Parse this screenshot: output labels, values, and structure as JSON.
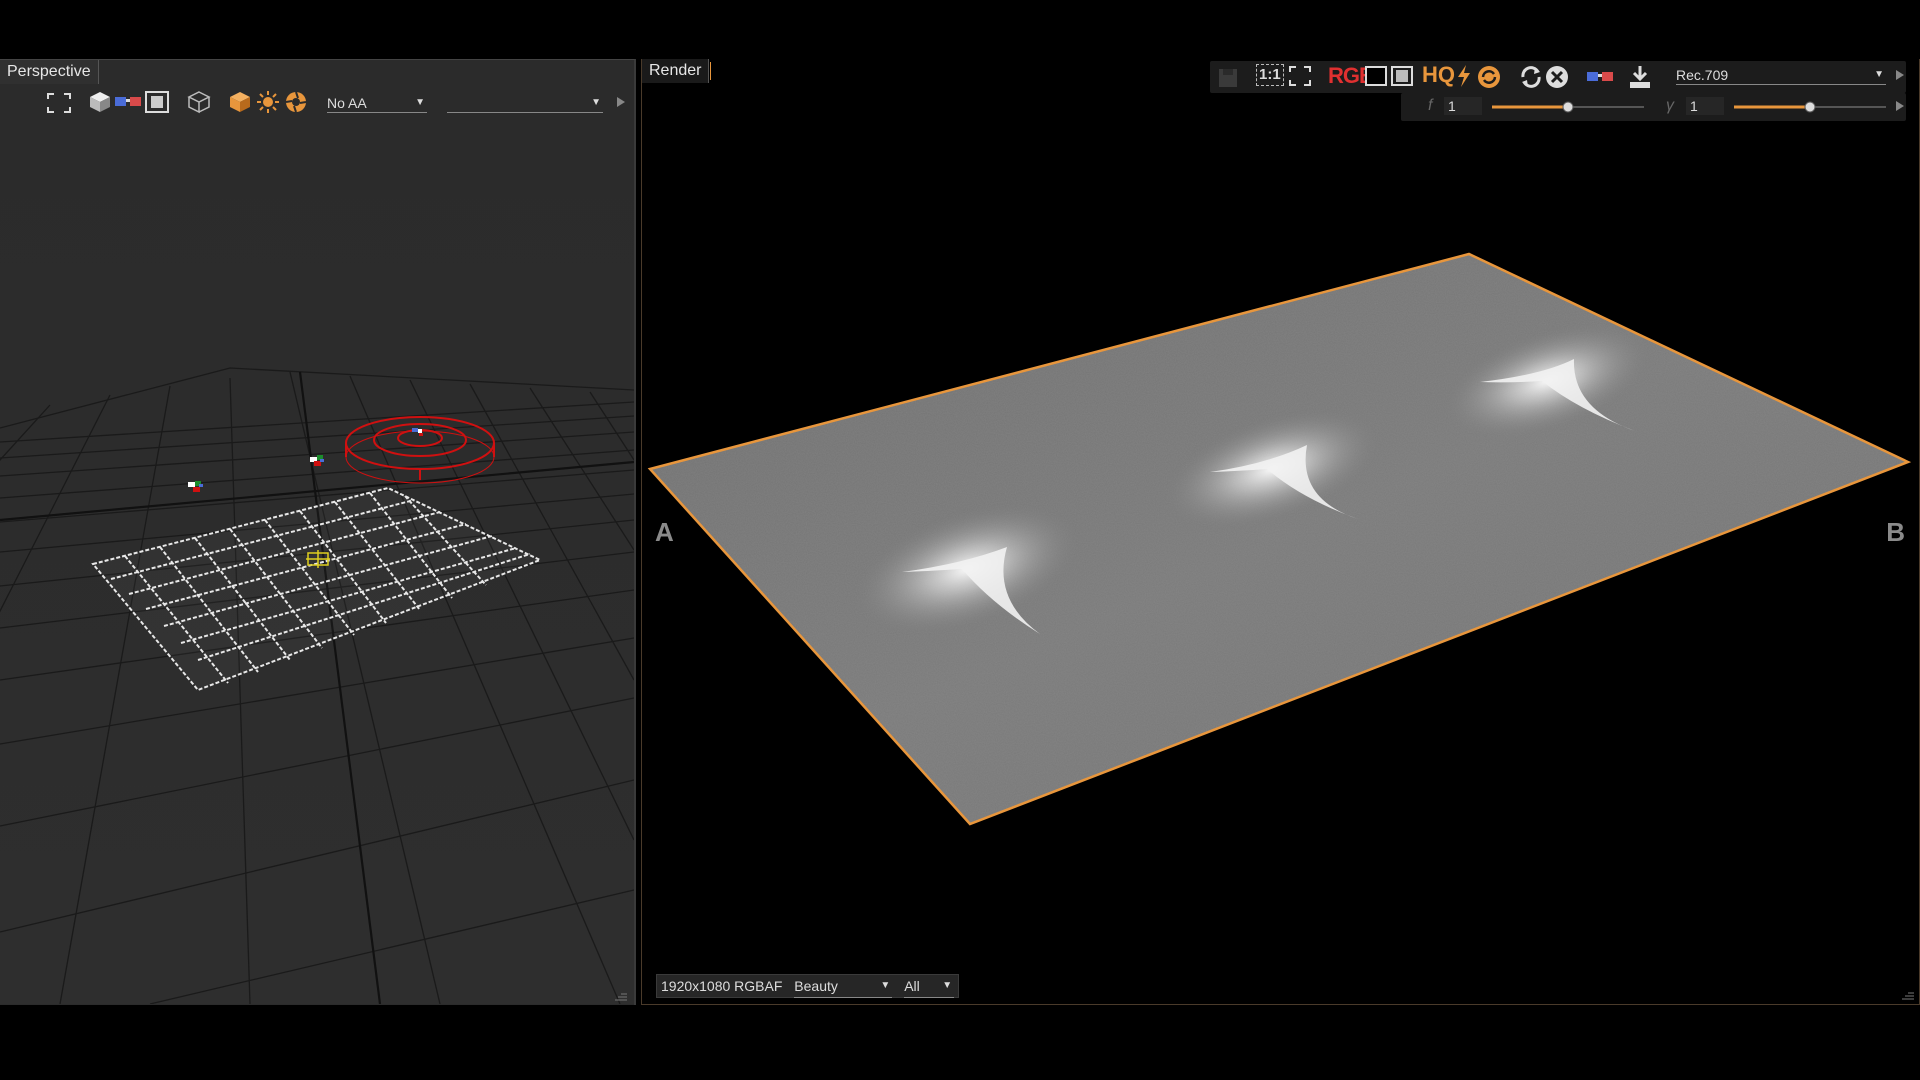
{
  "left_panel": {
    "tab_label": "Perspective",
    "toolbar": {
      "aa_select": "No AA",
      "second_select": "",
      "icons": [
        "fit-view-icon",
        "cube-icon",
        "stereo-glasses-icon",
        "frame-icon",
        "wireframe-cube-icon",
        "orange-cube-icon",
        "sun-light-icon",
        "shadow-icon"
      ]
    }
  },
  "right_panel": {
    "tab_label": "Render",
    "toolbar": {
      "icons": [
        "save-icon",
        "one-to-one-icon",
        "fit-icon",
        "rgb-channels-icon",
        "checker-icon",
        "fullscreen-icon",
        "hq-icon",
        "lightning-icon",
        "refresh-orange-icon",
        "reload-icon",
        "stop-icon",
        "stereo-icon",
        "export-icon"
      ],
      "rgb_label": "RGB",
      "hq_label": "HQ",
      "one_to_one_label": "1:1",
      "lut_select": "Rec.709",
      "gain_label": "f",
      "gain_value": "1",
      "gain_slider": 0.5,
      "gamma_label": "γ",
      "gamma_value": "1",
      "gamma_slider": 0.5
    },
    "marker_a": "A",
    "marker_b": "B",
    "status": {
      "resolution": "1920x1080 RGBAF",
      "pass_select": "Beauty",
      "layer_select": "All"
    }
  },
  "colors": {
    "accent_orange": "#e8963c",
    "selection_red": "#d01010"
  }
}
